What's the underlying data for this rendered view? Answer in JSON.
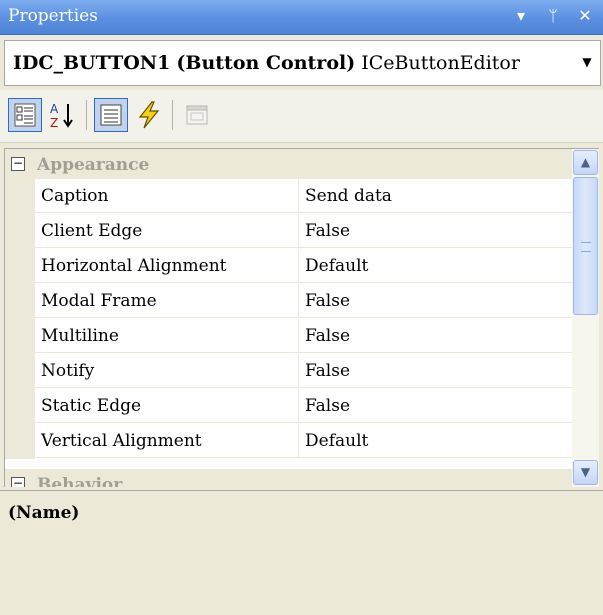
{
  "window": {
    "title": "Properties",
    "controls": {
      "dropdown_icon": "chevron-down-icon",
      "pin_icon": "pin-icon",
      "close_icon": "close-icon",
      "dropdown_glyph": "▾",
      "pin_glyph": "ᛘ",
      "close_glyph": "✕"
    }
  },
  "object_selector": {
    "object_name": "IDC_BUTTON1",
    "object_type": "(Button Control)",
    "editor": "ICeButtonEditor"
  },
  "toolbar": {
    "buttons": [
      {
        "name": "categorized-icon",
        "active": true
      },
      {
        "name": "alphabetical-icon",
        "active": false
      },
      {
        "name": "properties-icon",
        "active": true
      },
      {
        "name": "events-icon",
        "active": false
      },
      {
        "name": "property-pages-icon",
        "active": false
      }
    ]
  },
  "grid": {
    "categories": [
      {
        "label": "Appearance",
        "expanded": true,
        "toggle": "−",
        "properties": [
          {
            "name": "Caption",
            "value": "Send data"
          },
          {
            "name": "Client Edge",
            "value": "False"
          },
          {
            "name": "Horizontal Alignment",
            "value": "Default"
          },
          {
            "name": "Modal Frame",
            "value": "False"
          },
          {
            "name": "Multiline",
            "value": "False"
          },
          {
            "name": "Notify",
            "value": "False"
          },
          {
            "name": "Static Edge",
            "value": "False"
          },
          {
            "name": "Vertical Alignment",
            "value": "Default"
          }
        ]
      },
      {
        "label": "Behavior",
        "expanded": true,
        "toggle": "−"
      }
    ]
  },
  "scrollbar": {
    "up_glyph": "▲",
    "down_glyph": "▼"
  },
  "description": {
    "name": "(Name)",
    "text": ""
  },
  "colors": {
    "titlebar": "#5b8fe0",
    "category_text": "#a09f96",
    "selection": "#c1d2ee"
  }
}
